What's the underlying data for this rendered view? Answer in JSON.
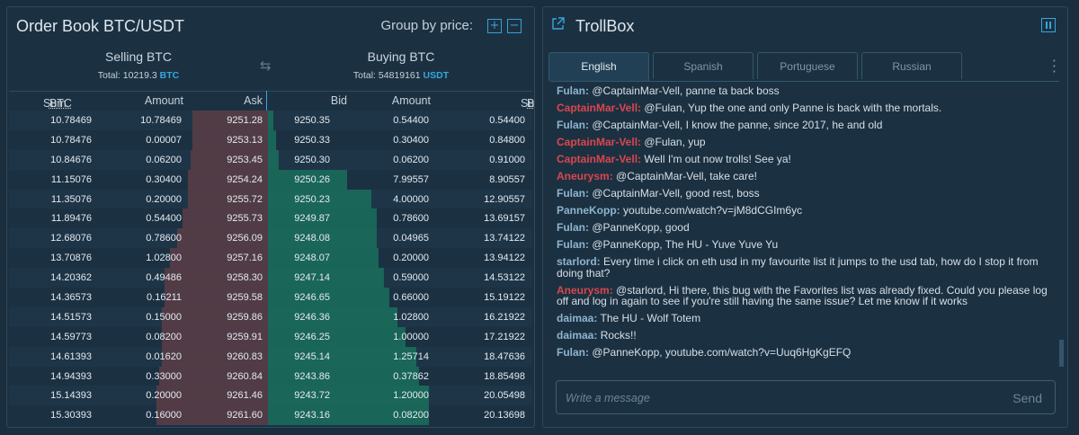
{
  "order_book": {
    "title": "Order Book BTC/USDT",
    "group_label": "Group by price:",
    "group_plus": "+",
    "group_minus": "−",
    "selling": {
      "title": "Selling BTC",
      "total_label": "Total: 10219.3",
      "currency": "BTC"
    },
    "buying": {
      "title": "Buying BTC",
      "total_label": "Total: 54819161",
      "currency": "USDT"
    },
    "columns": {
      "sum": "Sum",
      "sum_unit": "BTC",
      "amount": "Amount",
      "ask": "Ask",
      "bid": "Bid",
      "amount2": "Amount",
      "sum2": "Sum",
      "sum2_unit": "BTC"
    },
    "rows": [
      {
        "sum": "10.78469",
        "amount": "10.78469",
        "ask": "9251.28",
        "bid": "9250.35",
        "amount2": "0.54400",
        "sum2": "0.54400",
        "sell_depth": 0.29,
        "buy_depth": 0.02
      },
      {
        "sum": "10.78476",
        "amount": "0.00007",
        "ask": "9253.13",
        "bid": "9250.33",
        "amount2": "0.30400",
        "sum2": "0.84800",
        "sell_depth": 0.29,
        "buy_depth": 0.03
      },
      {
        "sum": "10.84676",
        "amount": "0.06200",
        "ask": "9253.45",
        "bid": "9250.30",
        "amount2": "0.06200",
        "sum2": "0.91000",
        "sell_depth": 0.3,
        "buy_depth": 0.04
      },
      {
        "sum": "11.15076",
        "amount": "0.30400",
        "ask": "9254.24",
        "bid": "9250.26",
        "amount2": "7.99557",
        "sum2": "8.90557",
        "sell_depth": 0.31,
        "buy_depth": 0.3
      },
      {
        "sum": "11.35076",
        "amount": "0.20000",
        "ask": "9255.72",
        "bid": "9250.23",
        "amount2": "4.00000",
        "sum2": "12.90557",
        "sell_depth": 0.31,
        "buy_depth": 0.39
      },
      {
        "sum": "11.89476",
        "amount": "0.54400",
        "ask": "9255.73",
        "bid": "9249.87",
        "amount2": "0.78600",
        "sum2": "13.69157",
        "sell_depth": 0.33,
        "buy_depth": 0.41
      },
      {
        "sum": "12.68076",
        "amount": "0.78600",
        "ask": "9256.09",
        "bid": "9248.08",
        "amount2": "0.04965",
        "sum2": "13.74122",
        "sell_depth": 0.35,
        "buy_depth": 0.41
      },
      {
        "sum": "13.70876",
        "amount": "1.02800",
        "ask": "9257.16",
        "bid": "9248.07",
        "amount2": "0.20000",
        "sum2": "13.94122",
        "sell_depth": 0.38,
        "buy_depth": 0.42
      },
      {
        "sum": "14.20362",
        "amount": "0.49486",
        "ask": "9258.30",
        "bid": "9247.14",
        "amount2": "0.59000",
        "sum2": "14.53122",
        "sell_depth": 0.4,
        "buy_depth": 0.44
      },
      {
        "sum": "14.36573",
        "amount": "0.16211",
        "ask": "9259.58",
        "bid": "9246.65",
        "amount2": "0.66000",
        "sum2": "15.19122",
        "sell_depth": 0.4,
        "buy_depth": 0.46
      },
      {
        "sum": "14.51573",
        "amount": "0.15000",
        "ask": "9259.86",
        "bid": "9246.36",
        "amount2": "1.02800",
        "sum2": "16.21922",
        "sell_depth": 0.41,
        "buy_depth": 0.49
      },
      {
        "sum": "14.59773",
        "amount": "0.08200",
        "ask": "9259.91",
        "bid": "9246.25",
        "amount2": "1.00000",
        "sum2": "17.21922",
        "sell_depth": 0.41,
        "buy_depth": 0.52
      },
      {
        "sum": "14.61393",
        "amount": "0.01620",
        "ask": "9260.83",
        "bid": "9245.14",
        "amount2": "1.25714",
        "sum2": "18.47636",
        "sell_depth": 0.41,
        "buy_depth": 0.56
      },
      {
        "sum": "14.94393",
        "amount": "0.33000",
        "ask": "9260.84",
        "bid": "9243.86",
        "amount2": "0.37862",
        "sum2": "18.85498",
        "sell_depth": 0.42,
        "buy_depth": 0.57
      },
      {
        "sum": "15.14393",
        "amount": "0.20000",
        "ask": "9261.46",
        "bid": "9243.72",
        "amount2": "1.20000",
        "sum2": "20.05498",
        "sell_depth": 0.43,
        "buy_depth": 0.61
      },
      {
        "sum": "15.30393",
        "amount": "0.16000",
        "ask": "9261.60",
        "bid": "9243.16",
        "amount2": "0.08200",
        "sum2": "20.13698",
        "sell_depth": 0.43,
        "buy_depth": 0.61
      }
    ]
  },
  "trollbox": {
    "title": "TrollBox",
    "tabs": [
      "English",
      "Spanish",
      "Portuguese",
      "Russian"
    ],
    "active_tab": "English",
    "messages": [
      {
        "user": "Fulan:",
        "text": "@CaptainMar-Vell, panne ta back boss",
        "type": "fulan"
      },
      {
        "user": "CaptainMar-Vell:",
        "text": "@Fulan, Yup the one and only Panne is back with the mortals.",
        "type": "cap"
      },
      {
        "user": "Fulan:",
        "text": "@CaptainMar-Vell, I know the panne, since 2017, he and old",
        "type": "fulan"
      },
      {
        "user": "CaptainMar-Vell:",
        "text": "@Fulan, yup",
        "type": "cap"
      },
      {
        "user": "CaptainMar-Vell:",
        "text": "Well I'm out now trolls! See ya!",
        "type": "cap"
      },
      {
        "user": "Aneurysm:",
        "text": "@CaptainMar-Vell, take care!",
        "type": "cap"
      },
      {
        "user": "Fulan:",
        "text": "@CaptainMar-Vell, good rest, boss",
        "type": "fulan"
      },
      {
        "user": "PanneKopp:",
        "text": "youtube.com/watch?v=jM8dCGIm6yc",
        "type": "pk"
      },
      {
        "user": "Fulan:",
        "text": "@PanneKopp, good",
        "type": "fulan"
      },
      {
        "user": "Fulan:",
        "text": "@PanneKopp, The HU - Yuve Yuve Yu",
        "type": "fulan"
      },
      {
        "user": "starlord:",
        "text": "Every time i click on eth usd in my favourite list it jumps to the usd tab, how do I stop it from doing that?",
        "type": "star"
      },
      {
        "user": "Aneurysm:",
        "text": "@starlord, Hi there, this bug with the Favorites list was already fixed. Could you please log off and log in again to see if you're still having the same issue? Let me know if it works",
        "type": "cap"
      },
      {
        "user": "daimaa:",
        "text": "The HU - Wolf Totem",
        "type": "dai"
      },
      {
        "user": "daimaa:",
        "text": "Rocks!!",
        "type": "dai"
      },
      {
        "user": "Fulan:",
        "text": "@PanneKopp, youtube.com/watch?v=Uuq6HgKgEFQ",
        "type": "fulan"
      }
    ],
    "input_placeholder": "Write a message",
    "send_label": "Send"
  }
}
